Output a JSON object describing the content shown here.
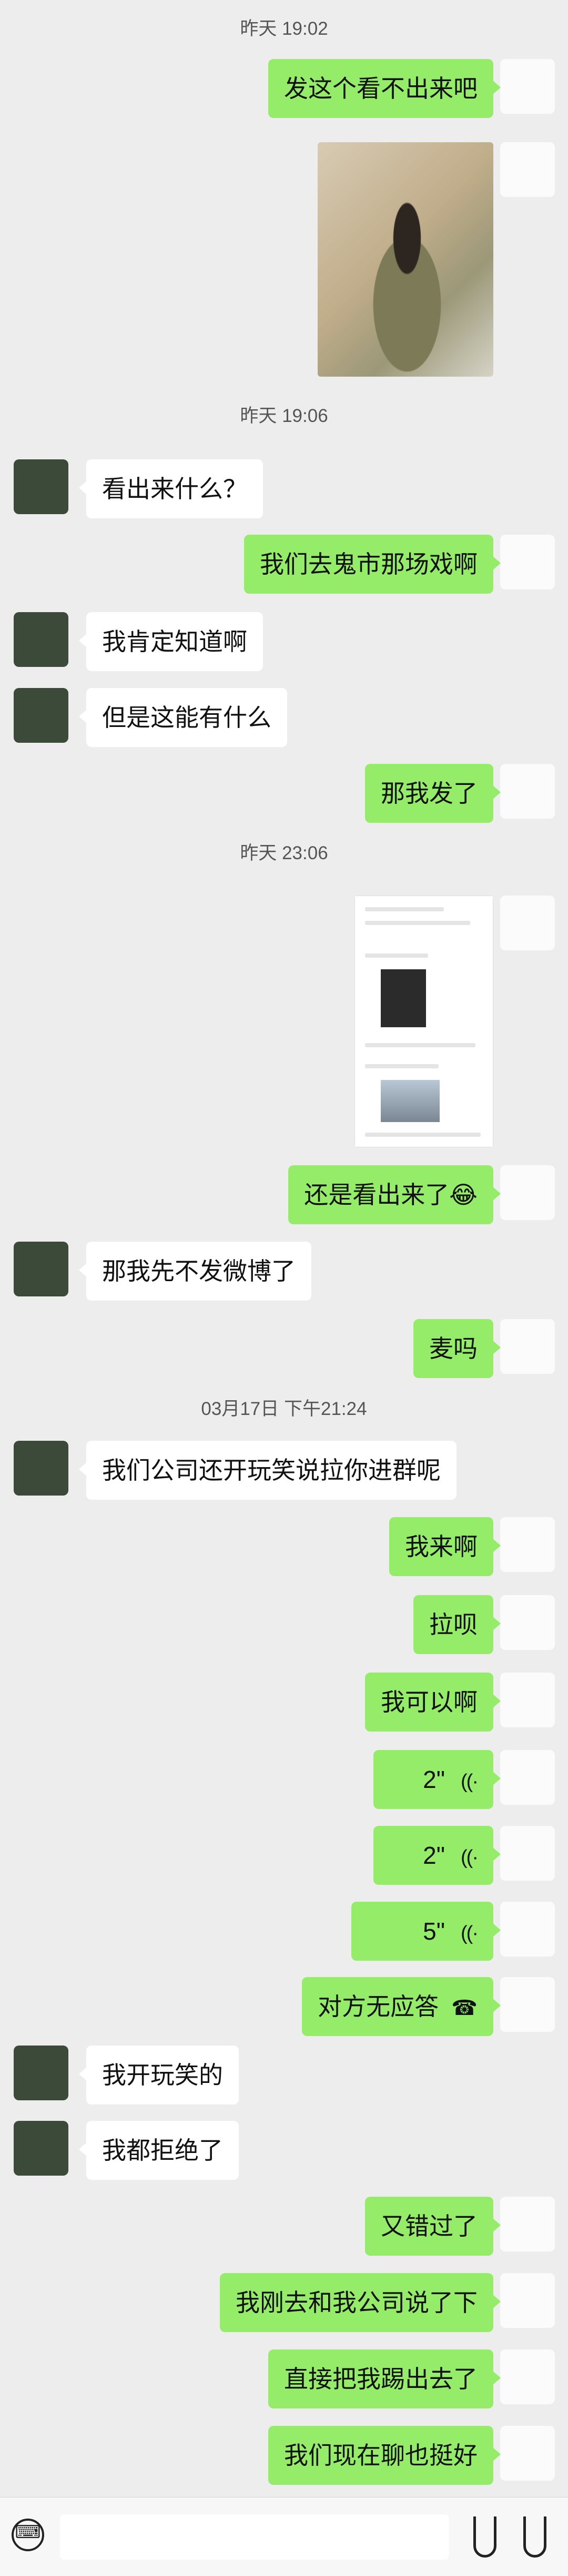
{
  "timestamps": [
    "昨天 19:02",
    "昨天 19:06",
    "昨天 23:06",
    "03月17日 下午21:24"
  ],
  "messages": {
    "m1": "发这个看不出来吧",
    "m3": "看出来什么？",
    "m4": "我们去鬼市那场戏啊",
    "m5": "我肯定知道啊",
    "m6": "但是这能有什么",
    "m7": "那我发了",
    "m9": "还是看出来了😂",
    "m10": "那我先不发微博了",
    "m11": "麦吗",
    "m12": "我们公司还开玩笑说拉你进群呢",
    "m13": "我来啊",
    "m14": "拉呗",
    "m15": "我可以啊",
    "m16": "2\"",
    "m17": "2\"",
    "m18": "5\"",
    "m19": "对方无应答",
    "m20": "我开玩笑的",
    "m21": "我都拒绝了",
    "m22": "又错过了",
    "m23": "我刚去和我公司说了下",
    "m24": "直接把我踢出去了",
    "m25": "我们现在聊也挺好"
  },
  "icons": {
    "voice": "((·",
    "call": "☎"
  },
  "colors": {
    "sent_bubble": "#95ec69",
    "received_bubble": "#ffffff",
    "background": "#ededed"
  }
}
